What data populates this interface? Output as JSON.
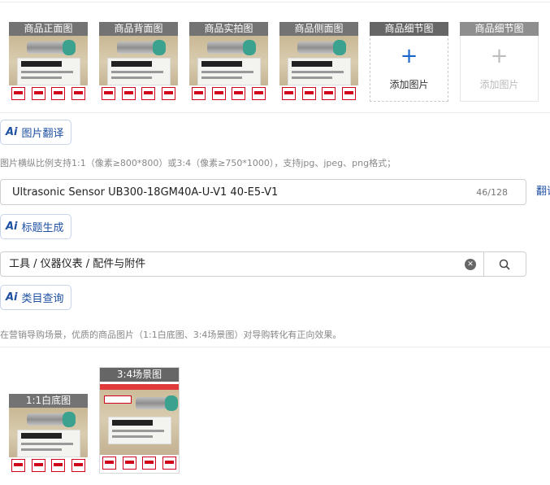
{
  "images": {
    "main_captions": [
      "商品正面图",
      "商品背面图",
      "商品实拍图",
      "商品侧面图"
    ],
    "detail_caption_1": "商品细节图",
    "detail_caption_2": "商品细节图",
    "add_image_label": "添加图片",
    "add_image_label_disabled": "添加图片"
  },
  "image_translate": {
    "button_label": "图片翻译",
    "ai_mark": "Ai"
  },
  "image_hint": "图片横纵比例支持1:1（像素≥800*800）或3:4（像素≥750*1000），支持jpg、jpeg、png格式；",
  "title_field": {
    "value": "Ultrasonic Sensor UB300-18GM40A-U-V1 40-E5-V1",
    "counter": "46/128",
    "translate_link": "翻译"
  },
  "title_generate": {
    "button_label": "标题生成",
    "ai_mark": "Ai"
  },
  "category_field": {
    "value": "工具 / 仪器仪表 / 配件与附件",
    "clear_icon": "clear-icon",
    "search_icon": "search-icon"
  },
  "category_query": {
    "button_label": "类目查询",
    "ai_mark": "Ai"
  },
  "guide_hint": "在营销导购场景，优质的商品图片（1:1白底图、3:4场景图）对导购转化有正向效果。",
  "guide_images": {
    "white_bg_caption": "1:1白底图",
    "scene_caption": "3:4场景图"
  },
  "colors": {
    "accent": "#1e50a2",
    "caption_bg": "#666666",
    "badge_red": "#d0021b",
    "sensor_tip": "#3aa28f"
  }
}
